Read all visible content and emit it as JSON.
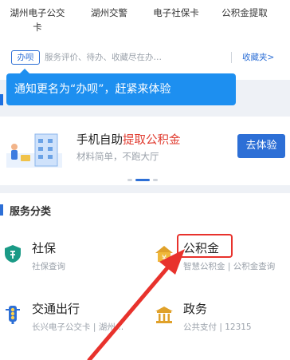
{
  "shortcuts": [
    {
      "line1": "湖州电子公交",
      "line2": "卡"
    },
    {
      "line1": "湖州交警",
      "line2": ""
    },
    {
      "line1": "电子社保卡",
      "line2": ""
    },
    {
      "line1": "公积金提取",
      "line2": ""
    }
  ],
  "office": {
    "tag": "办呗",
    "hint": "服务评价、待办、收藏尽在办…",
    "collect_link": "收藏夹>"
  },
  "tip": {
    "text": "通知更名为“办呗”，赶紧来体验"
  },
  "banner": {
    "title_prefix": "手机自助",
    "title_highlight": "提取公积金",
    "subtitle": "材料简单，不跑大厅",
    "button": "去体验"
  },
  "services": {
    "section_title": "服务分类",
    "items": [
      {
        "name": "社保",
        "desc": "社保查询",
        "icon": "shield-icon"
      },
      {
        "name": "公积金",
        "desc": "智慧公积金 | 公积金查询",
        "icon": "house-yen-icon"
      },
      {
        "name": "交通出行",
        "desc": "长兴电子公交卡 | 湖州…",
        "icon": "traffic-light-icon"
      },
      {
        "name": "政务",
        "desc": "公共支付 | 12315",
        "icon": "government-building-icon"
      }
    ]
  },
  "colors": {
    "accent": "#2d6fd6",
    "tip_bg": "#1d8ff0",
    "highlight_red": "#e03a2e",
    "annotation_red": "#e8322c",
    "shield_green": "#1a9a86",
    "gold": "#e0a12a"
  }
}
